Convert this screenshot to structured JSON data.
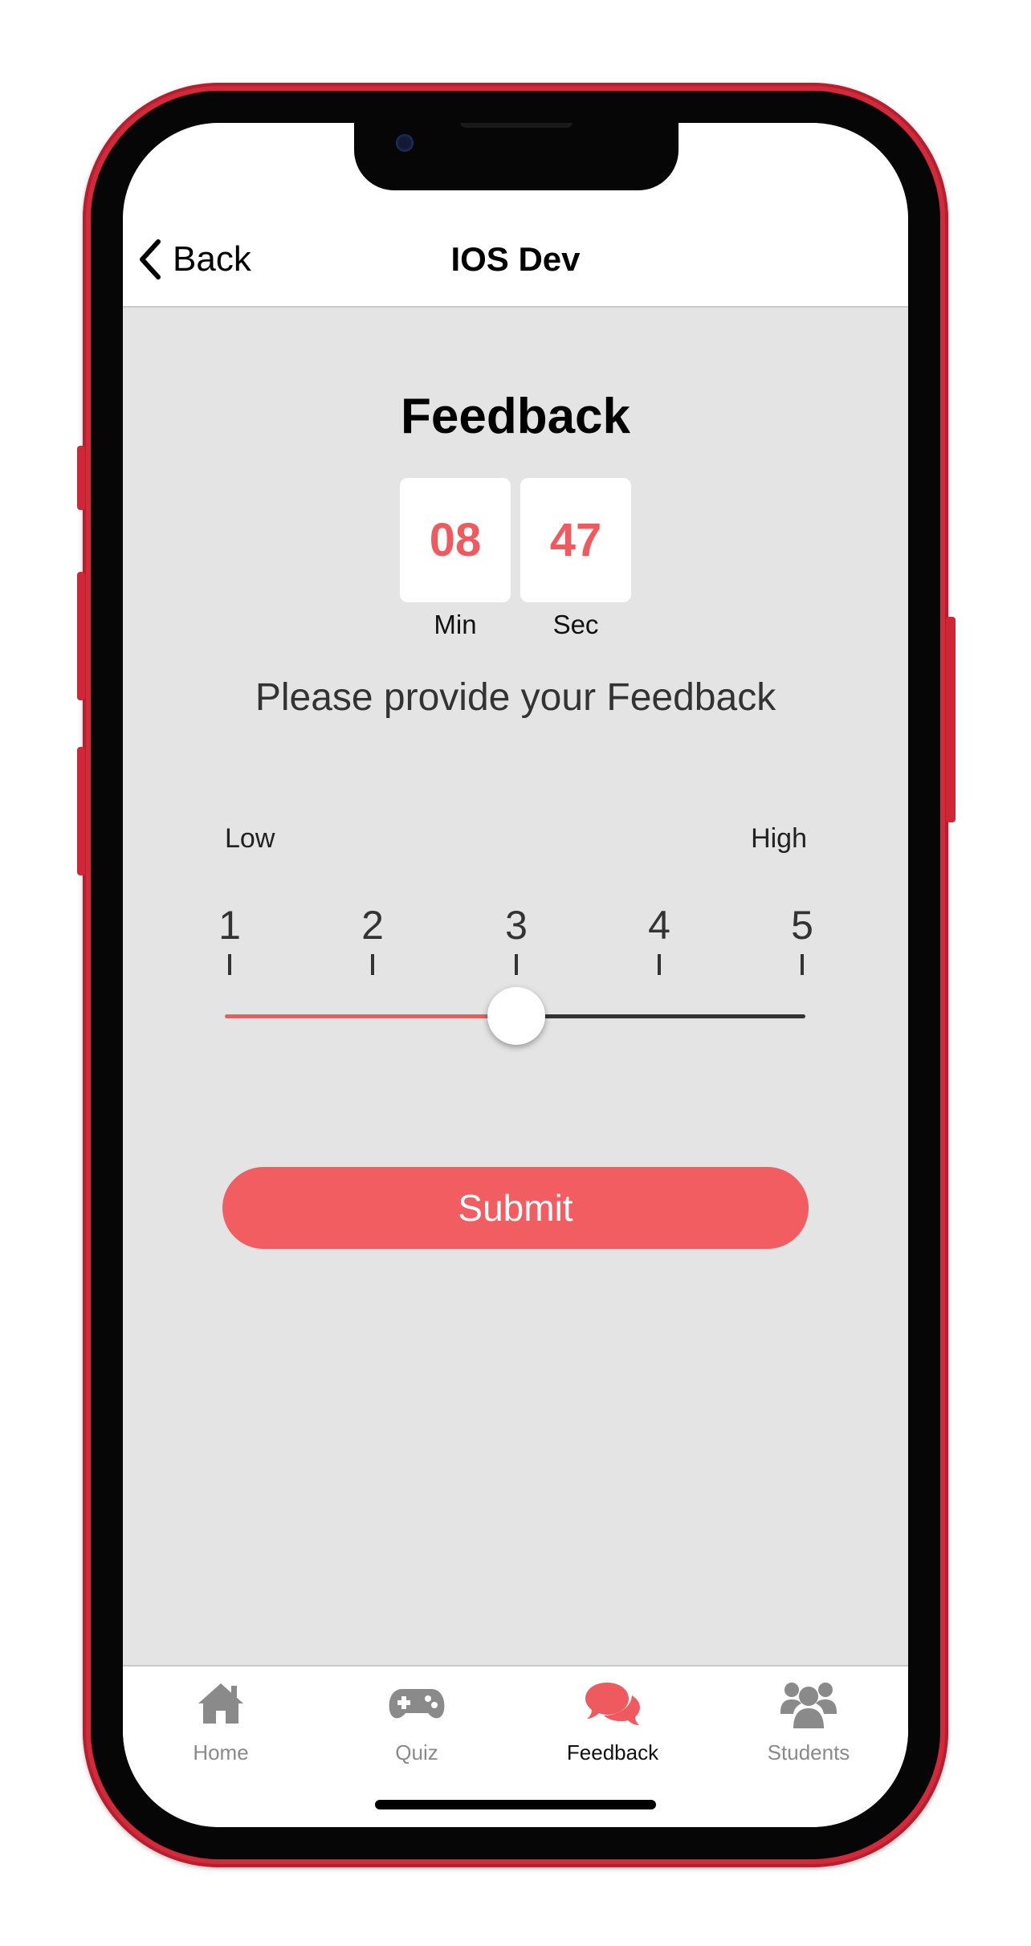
{
  "nav": {
    "back_label": "Back",
    "title": "IOS Dev"
  },
  "page": {
    "heading": "Feedback",
    "timer": {
      "minutes": "08",
      "minutes_label": "Min",
      "seconds": "47",
      "seconds_label": "Sec"
    },
    "prompt": "Please provide your Feedback"
  },
  "rating": {
    "low_label": "Low",
    "high_label": "High",
    "ticks": [
      "1",
      "2",
      "3",
      "4",
      "5"
    ],
    "value": 3,
    "min": 1,
    "max": 5,
    "fill_color": "#ef5a5e",
    "track_color": "#333333"
  },
  "submit_label": "Submit",
  "tabs": [
    {
      "label": "Home",
      "icon": "home-icon",
      "active": false
    },
    {
      "label": "Quiz",
      "icon": "gamepad-icon",
      "active": false
    },
    {
      "label": "Feedback",
      "icon": "chat-bubbles-icon",
      "active": true
    },
    {
      "label": "Students",
      "icon": "users-icon",
      "active": false
    }
  ],
  "colors": {
    "accent": "#f15d60",
    "frame": "#d22a3a",
    "background": "#e4e4e4",
    "inactive_tab": "#8a8a8a"
  }
}
